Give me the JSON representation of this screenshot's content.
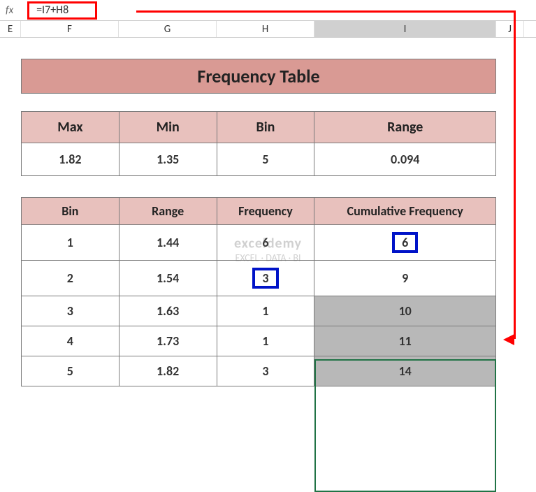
{
  "formula_bar": {
    "fx": "fx",
    "formula": "=I7+H8"
  },
  "columns": {
    "e": "E",
    "f": "F",
    "g": "G",
    "h": "H",
    "i": "I",
    "j": "J"
  },
  "title": "Frequency Table",
  "stats": {
    "headers": {
      "max": "Max",
      "min": "Min",
      "bin": "Bin",
      "range": "Range"
    },
    "values": {
      "max": "1.82",
      "min": "1.35",
      "bin": "5",
      "range": "0.094"
    }
  },
  "freq": {
    "headers": {
      "bin": "Bin",
      "range": "Range",
      "frequency": "Frequency",
      "cumulative": "Cumulative Frequency"
    },
    "rows": [
      {
        "bin": "1",
        "range": "1.44",
        "frequency": "6",
        "cumulative": "6"
      },
      {
        "bin": "2",
        "range": "1.54",
        "frequency": "3",
        "cumulative": "9"
      },
      {
        "bin": "3",
        "range": "1.63",
        "frequency": "1",
        "cumulative": "10"
      },
      {
        "bin": "4",
        "range": "1.73",
        "frequency": "1",
        "cumulative": "11"
      },
      {
        "bin": "5",
        "range": "1.82",
        "frequency": "3",
        "cumulative": "14"
      }
    ]
  },
  "watermark": {
    "title": "exceldemy",
    "sub": "EXCEL · DATA · BI"
  },
  "chart_data": {
    "type": "table",
    "title": "Frequency Table",
    "summary": {
      "Max": 1.82,
      "Min": 1.35,
      "Bin": 5,
      "Range": 0.094
    },
    "columns": [
      "Bin",
      "Range",
      "Frequency",
      "Cumulative Frequency"
    ],
    "rows": [
      [
        1,
        1.44,
        6,
        6
      ],
      [
        2,
        1.54,
        3,
        9
      ],
      [
        3,
        1.63,
        1,
        10
      ],
      [
        4,
        1.73,
        1,
        11
      ],
      [
        5,
        1.82,
        3,
        14
      ]
    ]
  }
}
